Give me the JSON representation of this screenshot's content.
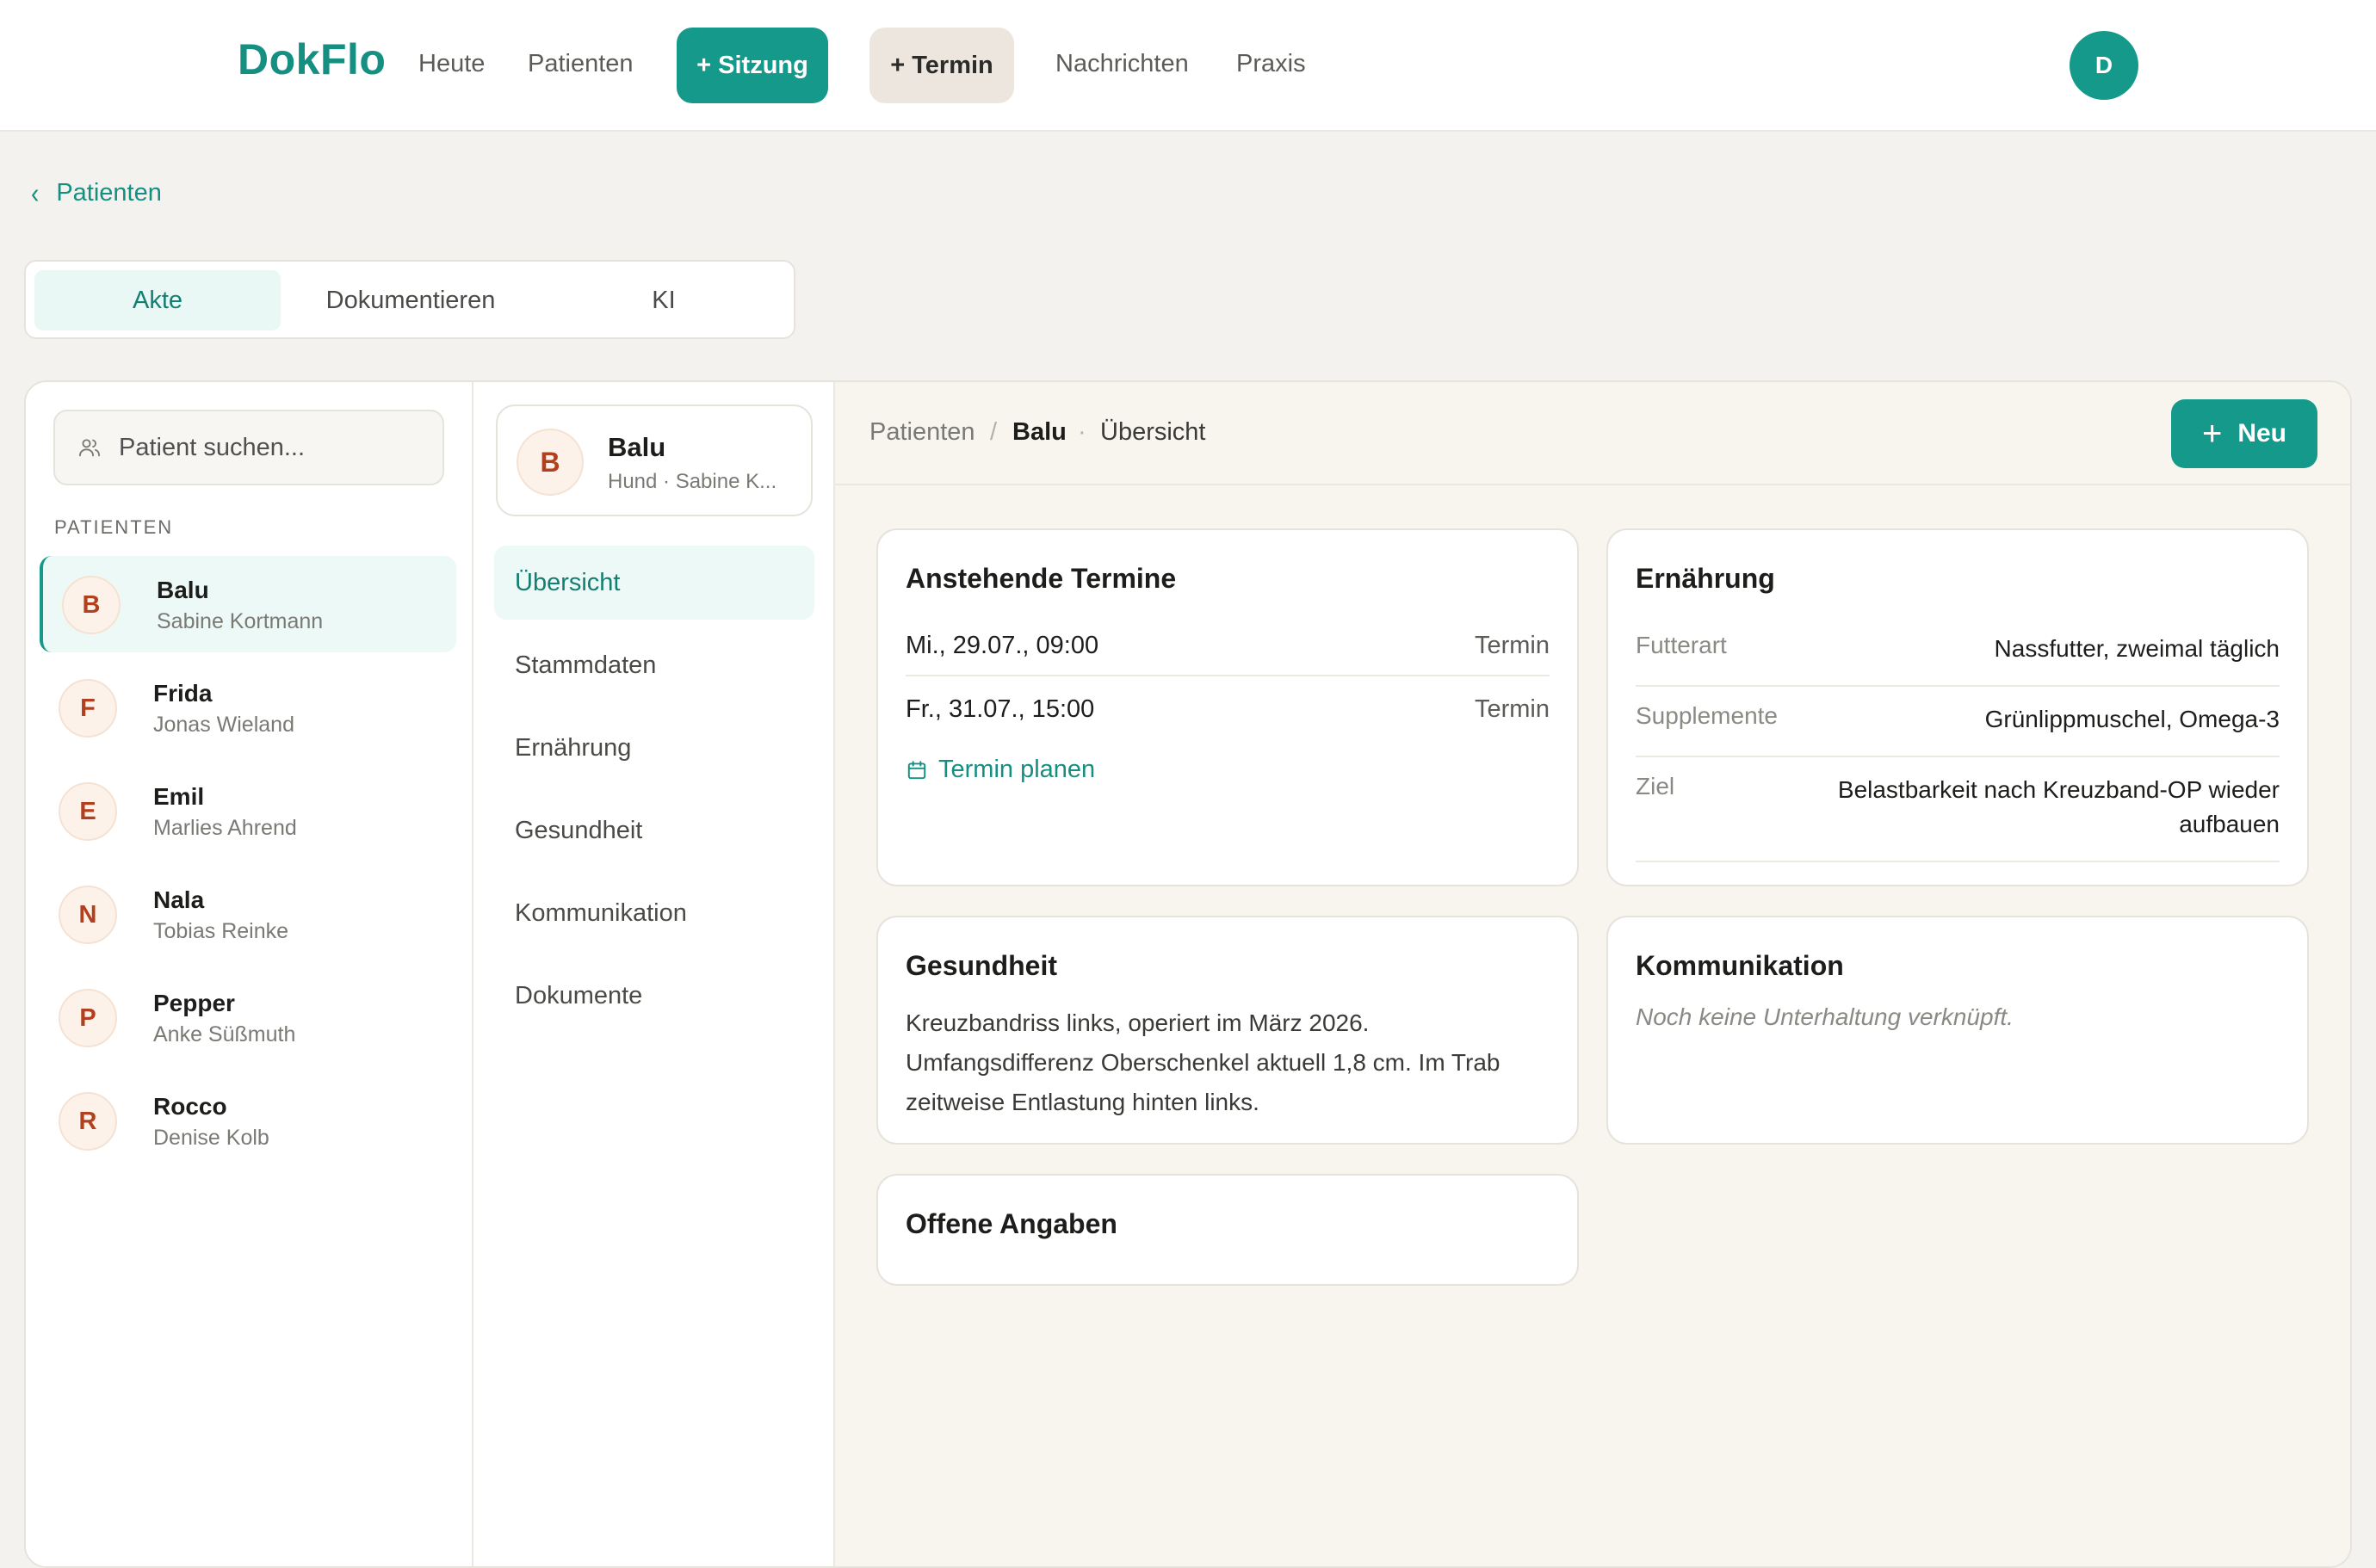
{
  "app": {
    "logo": "DokFlo",
    "user_initial": "D"
  },
  "nav": {
    "today": "Heute",
    "patients": "Patienten",
    "new_session": "+ Sitzung",
    "new_appointment": "+ Termin",
    "messages": "Nachrichten",
    "practice": "Praxis"
  },
  "back_link": "Patienten",
  "mode_tabs": [
    "Akte",
    "Dokumentieren",
    "KI"
  ],
  "mode_tabs_active": "Akte",
  "patient_list": {
    "search_placeholder": "Patient suchen...",
    "heading": "PATIENTEN",
    "items": [
      {
        "initial": "B",
        "name": "Balu",
        "owner": "Sabine Kortmann",
        "active": true
      },
      {
        "initial": "F",
        "name": "Frida",
        "owner": "Jonas Wieland"
      },
      {
        "initial": "E",
        "name": "Emil",
        "owner": "Marlies Ahrend"
      },
      {
        "initial": "N",
        "name": "Nala",
        "owner": "Tobias Reinke"
      },
      {
        "initial": "P",
        "name": "Pepper",
        "owner": "Anke Süßmuth"
      },
      {
        "initial": "R",
        "name": "Rocco",
        "owner": "Denise Kolb"
      }
    ]
  },
  "selected_patient": {
    "initial": "B",
    "name": "Balu",
    "subtitle": "Hund · Sabine K..."
  },
  "sections": [
    "Übersicht",
    "Stammdaten",
    "Ernährung",
    "Gesundheit",
    "Kommunikation",
    "Dokumente"
  ],
  "sections_active": "Übersicht",
  "breadcrumb": {
    "root": "Patienten",
    "separator": "/",
    "current": "Balu",
    "dot": "·",
    "page": "Übersicht"
  },
  "new_button": "Neu",
  "cards": {
    "appointments": {
      "title": "Anstehende Termine",
      "rows": [
        {
          "date": "Mi., 29.07., 09:00",
          "type": "Termin"
        },
        {
          "date": "Fr., 31.07., 15:00",
          "type": "Termin"
        }
      ],
      "plan_link": "Termin planen"
    },
    "nutrition": {
      "title": "Ernährung",
      "rows": [
        {
          "key": "Futterart",
          "value": "Nassfutter, zweimal täglich"
        },
        {
          "key": "Supplemente",
          "value": "Grünlippmuschel, Omega-3"
        },
        {
          "key": "Ziel",
          "value": "Belastbarkeit nach Kreuzband-OP wieder aufbauen"
        }
      ]
    },
    "health": {
      "title": "Gesundheit",
      "text": "Kreuzbandriss links, operiert im März 2026. Umfangsdifferenz Oberschenkel aktuell 1,8 cm. Im Trab zeitweise Entlastung hinten links."
    },
    "communication": {
      "title": "Kommunikation",
      "empty": "Noch keine Unterhaltung verknüpft."
    },
    "open_items": {
      "title": "Offene Angaben"
    }
  },
  "colors": {
    "accent": "#14998a",
    "background": "#f4f2ee",
    "content_bg": "#f8f5ee",
    "avatar_text": "#b1401f"
  }
}
